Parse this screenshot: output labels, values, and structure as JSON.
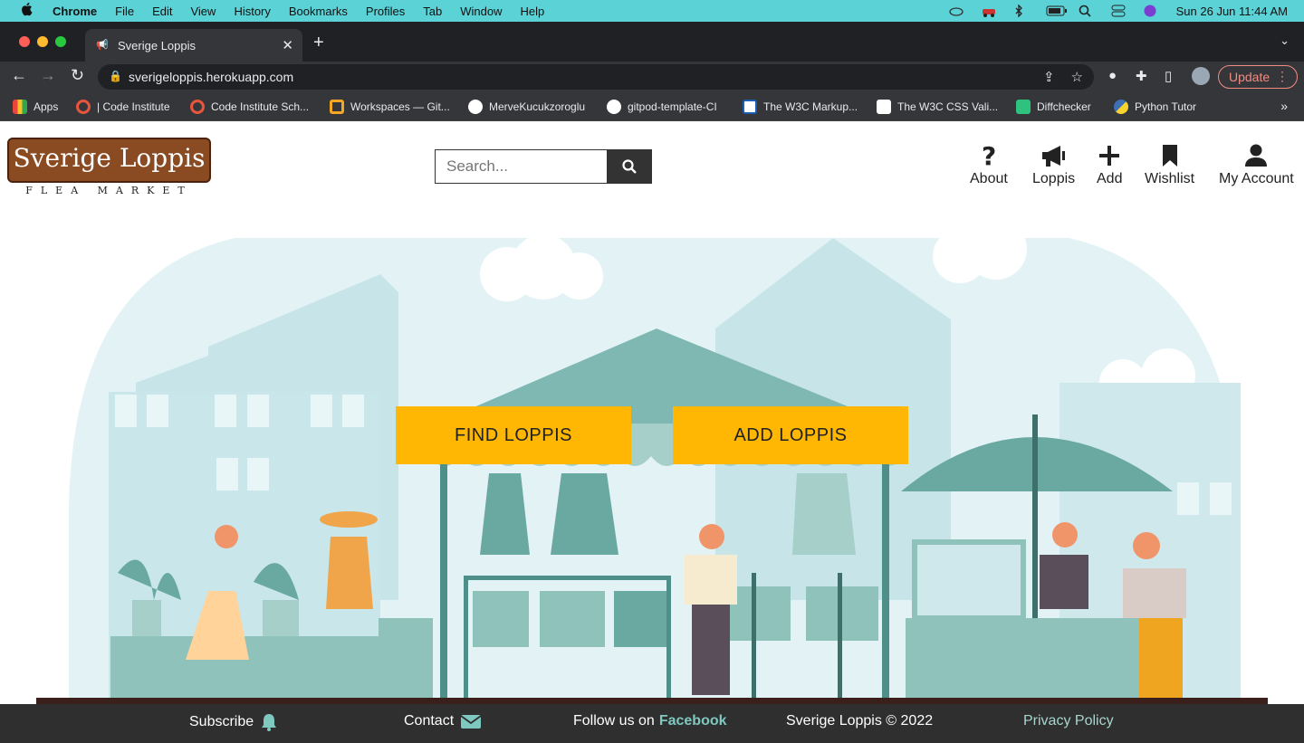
{
  "menubar": {
    "app": "Chrome",
    "items": [
      "File",
      "Edit",
      "View",
      "History",
      "Bookmarks",
      "Profiles",
      "Tab",
      "Window",
      "Help"
    ],
    "clock": "Sun 26 Jun  11:44 AM"
  },
  "browser": {
    "tab_title": "Sverige Loppis",
    "url": "sverigeloppis.herokuapp.com",
    "update_label": "Update"
  },
  "bookmarks": [
    {
      "label": "Apps",
      "icon": "apps-grid-icon",
      "color": "#e8453c"
    },
    {
      "label": "| Code Institute",
      "icon": "code-institute-icon",
      "color": "#e8553c"
    },
    {
      "label": "Code Institute Sch...",
      "icon": "code-institute-icon",
      "color": "#e8553c"
    },
    {
      "label": "Workspaces — Git...",
      "icon": "gitpod-icon",
      "color": "#f5a623"
    },
    {
      "label": "MerveKucukzoroglu",
      "icon": "github-icon",
      "color": "#ffffff"
    },
    {
      "label": "gitpod-template-CI",
      "icon": "github-icon",
      "color": "#ffffff"
    },
    {
      "label": "The W3C Markup...",
      "icon": "w3c-icon",
      "color": "#1a5fb4"
    },
    {
      "label": "The W3C CSS Vali...",
      "icon": "w3c-css-icon",
      "color": "#ffffff"
    },
    {
      "label": "Diffchecker",
      "icon": "diffchecker-icon",
      "color": "#2ec27e"
    },
    {
      "label": "Python Tutor",
      "icon": "python-icon",
      "color": "#f6d32d"
    }
  ],
  "site": {
    "logo_name": "Sverige Loppis",
    "logo_tag": "FLEA MARKET",
    "search_placeholder": "Search...",
    "nav": [
      {
        "label": "About",
        "icon": "question-icon"
      },
      {
        "label": "Loppis",
        "icon": "megaphone-icon"
      },
      {
        "label": "Add",
        "icon": "plus-icon"
      },
      {
        "label": "Wishlist",
        "icon": "bookmark-icon"
      },
      {
        "label": "My Account",
        "icon": "user-icon"
      }
    ],
    "cta_find": "FIND LOPPIS",
    "cta_add": "ADD LOPPIS"
  },
  "footer": {
    "subscribe": "Subscribe",
    "contact": "Contact",
    "follow_prefix": "Follow us on",
    "follow_link": "Facebook",
    "copyright": "Sverige Loppis © 2022",
    "privacy": "Privacy Policy"
  },
  "colors": {
    "menubar": "#5ad2d6",
    "cta": "#ffb703",
    "footer": "#2f2f2f",
    "accent": "#7fc8c0"
  }
}
